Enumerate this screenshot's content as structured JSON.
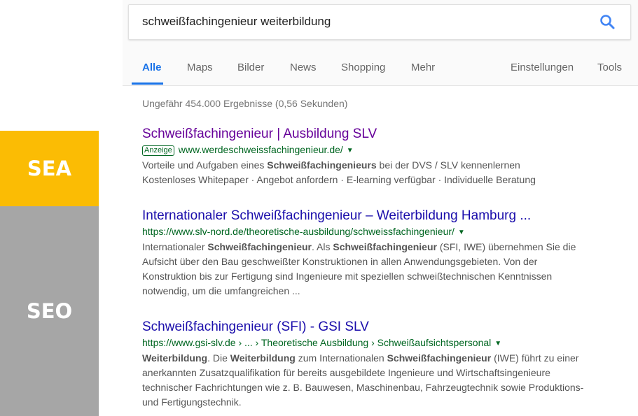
{
  "labels": {
    "sea": "SEA",
    "seo": "SEO"
  },
  "search": {
    "query": "schweißfachingenieur weiterbildung",
    "icon": "search-icon"
  },
  "tabs": [
    {
      "label": "Alle",
      "active": true
    },
    {
      "label": "Maps"
    },
    {
      "label": "Bilder"
    },
    {
      "label": "News"
    },
    {
      "label": "Shopping"
    },
    {
      "label": "Mehr"
    },
    {
      "label": "Einstellungen"
    },
    {
      "label": "Tools"
    }
  ],
  "result_stats": "Ungefähr 454.000 Ergebnisse (0,56 Sekunden)",
  "results": [
    {
      "title": "Schweißfachingenieur | Ausbildung SLV",
      "ad_badge": "Anzeige",
      "url": "www.werdeschweissfachingenieur.de/",
      "snippet": [
        [
          "Vorteile und Aufgaben eines ",
          ""
        ],
        [
          "Schweißfachingenieurs",
          "b"
        ],
        [
          " bei der DVS / SLV kennenlernen",
          ""
        ],
        [
          "\n",
          "br"
        ],
        [
          "Kostenloses Whitepaper · Angebot anfordern · E-learning verfügbar · Individuelle Beratung",
          ""
        ]
      ]
    },
    {
      "title": "Internationaler Schweißfachingenieur – Weiterbildung Hamburg ...",
      "url": "https://www.slv-nord.de/theoretische-ausbildung/schweissfachingenieur/",
      "snippet": [
        [
          "Internationaler ",
          ""
        ],
        [
          "Schweißfachingenieur",
          "b"
        ],
        [
          ". Als ",
          ""
        ],
        [
          "Schweißfachingenieur",
          "b"
        ],
        [
          " (SFI, IWE) übernehmen Sie die",
          ""
        ],
        [
          "\n",
          "br"
        ],
        [
          "Aufsicht über den Bau geschweißter Konstruktionen in allen Anwendungsgebieten. Von der",
          ""
        ],
        [
          "\n",
          "br"
        ],
        [
          "Konstruktion bis zur Fertigung sind Ingenieure mit speziellen schweißtechnischen Kenntnissen",
          ""
        ],
        [
          "\n",
          "br"
        ],
        [
          "notwendig, um die umfangreichen ...",
          ""
        ]
      ]
    },
    {
      "title": "Schweißfachingenieur (SFI) - GSI SLV",
      "url": "https://www.gsi-slv.de › ... › Theoretische Ausbildung › Schweißaufsichtspersonal",
      "snippet": [
        [
          "Weiterbildung",
          "b"
        ],
        [
          ". Die ",
          ""
        ],
        [
          "Weiterbildung",
          "b"
        ],
        [
          " zum Internationalen ",
          ""
        ],
        [
          "Schweißfachingenieur",
          "b"
        ],
        [
          " (IWE) führt zu einer",
          ""
        ],
        [
          "\n",
          "br"
        ],
        [
          "anerkannten Zusatzqualifikation für bereits ausgebildete Ingenieure und Wirtschaftsingenieure",
          ""
        ],
        [
          "\n",
          "br"
        ],
        [
          "technischer Fachrichtungen wie z. B. Bauwesen, Maschinenbau, Fahrzeugtechnik sowie Produktions-",
          ""
        ],
        [
          "\n",
          "br"
        ],
        [
          "und Fertigungstechnik.",
          ""
        ]
      ]
    }
  ],
  "colors": {
    "sea": "#fbbc04",
    "seo": "#a6a6a6",
    "link": "#1a0dab",
    "visited": "#660099",
    "url": "#006621",
    "snippet": "#545454",
    "accent": "#1a73e8"
  }
}
